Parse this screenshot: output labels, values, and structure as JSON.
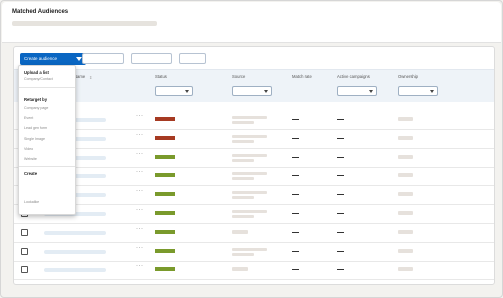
{
  "header": {
    "title": "Matched Audiences"
  },
  "toolbar": {
    "create_label": "Create audience"
  },
  "columns": {
    "name": "Name",
    "status": "Status",
    "source": "Source",
    "match_rate": "Match rate",
    "active_campaigns": "Active campaigns",
    "ownership": "Ownership"
  },
  "dropdown": {
    "upload_heading": "Upload a list",
    "upload_items": [
      "Company/Contact"
    ],
    "retarget_heading": "Retarget by",
    "retarget_items": [
      "Company page",
      "Event",
      "Lead gen form",
      "Single Image",
      "Video",
      "Website"
    ],
    "create_heading": "Create",
    "create_items": [
      "Lookalike"
    ]
  },
  "rows": [
    {
      "status": "red",
      "status_color": "#a63a22",
      "match_rate": "—",
      "active_campaigns": "—"
    },
    {
      "status": "red",
      "status_color": "#a63a22",
      "match_rate": "—",
      "active_campaigns": "—"
    },
    {
      "status": "green",
      "status_color": "#7a9a2c",
      "match_rate": "—",
      "active_campaigns": "—"
    },
    {
      "status": "green",
      "status_color": "#7a9a2c",
      "match_rate": "—",
      "active_campaigns": "—"
    },
    {
      "status": "green",
      "status_color": "#7a9a2c",
      "match_rate": "—",
      "active_campaigns": "—"
    },
    {
      "status": "green",
      "status_color": "#7a9a2c",
      "match_rate": "—",
      "active_campaigns": "—"
    },
    {
      "status": "green",
      "status_color": "#7a9a2c",
      "match_rate": "—",
      "active_campaigns": "—"
    },
    {
      "status": "green",
      "status_color": "#7a9a2c",
      "match_rate": "—",
      "active_campaigns": "—"
    },
    {
      "status": "green",
      "status_color": "#7a9a2c",
      "match_rate": "—",
      "active_campaigns": "—"
    }
  ],
  "colors": {
    "primary": "#0a66c2",
    "error": "#a63a22",
    "success": "#7a9a2c",
    "header_bg": "#eef3f8"
  },
  "icons": {
    "create_caret": "caret-down-icon",
    "sort": "sort-icon",
    "more": "more-horizontal-icon",
    "select_caret": "chevron-down-icon"
  }
}
